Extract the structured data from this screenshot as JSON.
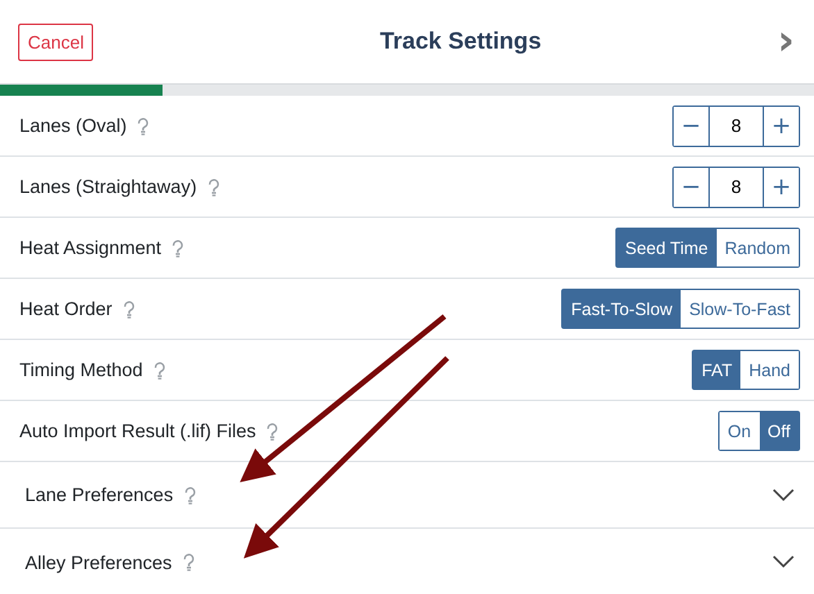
{
  "header": {
    "cancel": "Cancel",
    "title": "Track Settings",
    "next": "›"
  },
  "progress": {
    "level": 0.2
  },
  "rows": [
    {
      "kind": "stepper",
      "label": "Lanes (Oval)",
      "minus": "−",
      "value": "8",
      "plus": "+"
    },
    {
      "kind": "stepper",
      "label": "Lanes (Straightaway)",
      "minus": "−",
      "value": "8",
      "plus": "+"
    },
    {
      "kind": "segmented",
      "label": "Heat Assignment",
      "options": [
        {
          "label": "Seed Time",
          "selected": true
        },
        {
          "label": "Random",
          "selected": false
        }
      ]
    },
    {
      "kind": "segmented",
      "label": "Heat Order",
      "options": [
        {
          "label": "Fast-To-Slow",
          "selected": true
        },
        {
          "label": "Slow-To-Fast",
          "selected": false
        }
      ]
    },
    {
      "kind": "segmented",
      "label": "Timing Method",
      "options": [
        {
          "label": "FAT",
          "selected": true
        },
        {
          "label": "Hand",
          "selected": false
        }
      ]
    },
    {
      "kind": "segmented",
      "label": "Auto Import Result (.lif) Files",
      "options": [
        {
          "label": "On",
          "selected": false
        },
        {
          "label": "Off",
          "selected": true
        }
      ]
    },
    {
      "kind": "section",
      "label": "Lane Preferences",
      "expanded": false
    },
    {
      "kind": "section",
      "label": "Alley Preferences",
      "expanded": false
    }
  ]
}
